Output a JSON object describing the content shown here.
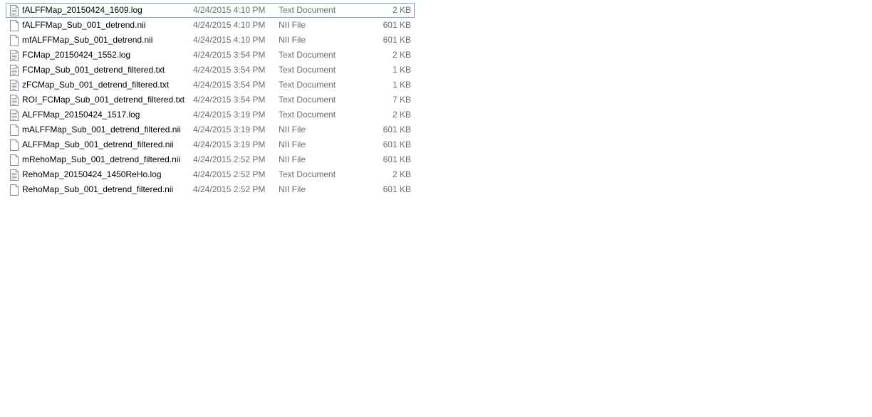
{
  "files": [
    {
      "name": "fALFFMap_20150424_1609.log",
      "date": "4/24/2015 4:10 PM",
      "type": "Text Document",
      "size": "2 KB",
      "icon": "text-document-icon",
      "focused": true
    },
    {
      "name": "fALFFMap_Sub_001_detrend.nii",
      "date": "4/24/2015 4:10 PM",
      "type": "NII File",
      "size": "601 KB",
      "icon": "generic-file-icon",
      "focused": false
    },
    {
      "name": "mfALFFMap_Sub_001_detrend.nii",
      "date": "4/24/2015 4:10 PM",
      "type": "NII File",
      "size": "601 KB",
      "icon": "generic-file-icon",
      "focused": false
    },
    {
      "name": "FCMap_20150424_1552.log",
      "date": "4/24/2015 3:54 PM",
      "type": "Text Document",
      "size": "2 KB",
      "icon": "text-document-icon",
      "focused": false
    },
    {
      "name": "FCMap_Sub_001_detrend_filtered.txt",
      "date": "4/24/2015 3:54 PM",
      "type": "Text Document",
      "size": "1 KB",
      "icon": "text-document-icon",
      "focused": false
    },
    {
      "name": "zFCMap_Sub_001_detrend_filtered.txt",
      "date": "4/24/2015 3:54 PM",
      "type": "Text Document",
      "size": "1 KB",
      "icon": "text-document-icon",
      "focused": false
    },
    {
      "name": "ROI_FCMap_Sub_001_detrend_filtered.txt",
      "date": "4/24/2015 3:54 PM",
      "type": "Text Document",
      "size": "7 KB",
      "icon": "text-document-icon",
      "focused": false
    },
    {
      "name": "ALFFMap_20150424_1517.log",
      "date": "4/24/2015 3:19 PM",
      "type": "Text Document",
      "size": "2 KB",
      "icon": "text-document-icon",
      "focused": false
    },
    {
      "name": "mALFFMap_Sub_001_detrend_filtered.nii",
      "date": "4/24/2015 3:19 PM",
      "type": "NII File",
      "size": "601 KB",
      "icon": "generic-file-icon",
      "focused": false
    },
    {
      "name": "ALFFMap_Sub_001_detrend_filtered.nii",
      "date": "4/24/2015 3:19 PM",
      "type": "NII File",
      "size": "601 KB",
      "icon": "generic-file-icon",
      "focused": false
    },
    {
      "name": "mRehoMap_Sub_001_detrend_filtered.nii",
      "date": "4/24/2015 2:52 PM",
      "type": "NII File",
      "size": "601 KB",
      "icon": "generic-file-icon",
      "focused": false
    },
    {
      "name": "RehoMap_20150424_1450ReHo.log",
      "date": "4/24/2015 2:52 PM",
      "type": "Text Document",
      "size": "2 KB",
      "icon": "text-document-icon",
      "focused": false
    },
    {
      "name": "RehoMap_Sub_001_detrend_filtered.nii",
      "date": "4/24/2015 2:52 PM",
      "type": "NII File",
      "size": "601 KB",
      "icon": "generic-file-icon",
      "focused": false
    }
  ],
  "colors": {
    "focus_border": "#7da2ce",
    "secondary_text": "#6d6d6d",
    "primary_text": "#000000"
  }
}
